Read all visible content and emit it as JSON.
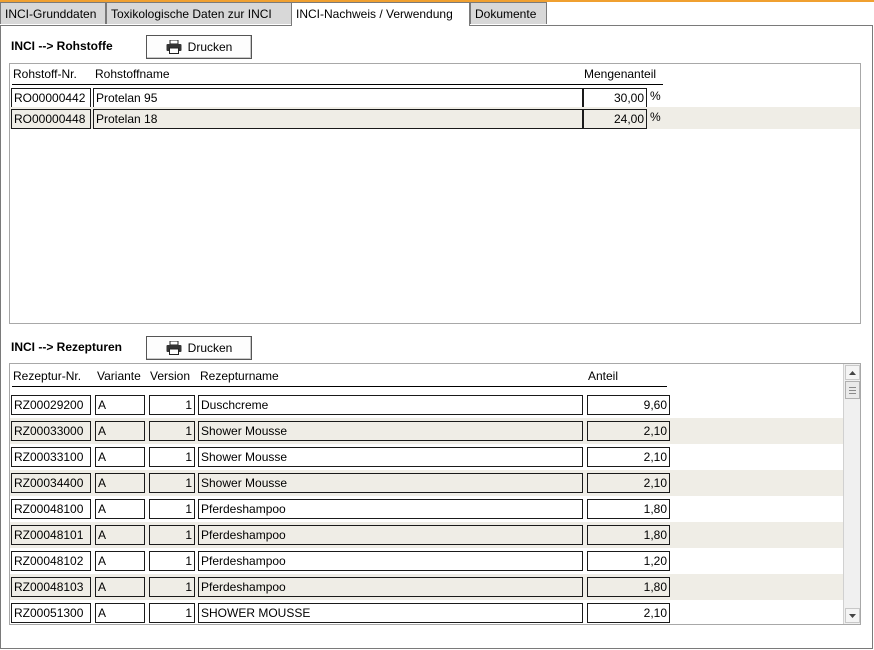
{
  "tabs": [
    {
      "label": "INCI-Grunddaten"
    },
    {
      "label": "Toxikologische Daten zur INCI"
    },
    {
      "label": "INCI-Nachweis / Verwendung"
    },
    {
      "label": "Dokumente"
    }
  ],
  "rohstoffe": {
    "title": "INCI --> Rohstoffe",
    "print_label": "Drucken",
    "columns": {
      "nr": "Rohstoff-Nr.",
      "name": "Rohstoffname",
      "menge": "Mengenanteil"
    },
    "rows": [
      {
        "nr": "RO00000442",
        "name": "Protelan 95",
        "menge": "30,00",
        "unit": "%"
      },
      {
        "nr": "RO00000448",
        "name": "Protelan 18",
        "menge": "24,00",
        "unit": "%"
      }
    ]
  },
  "rezepturen": {
    "title": "INCI --> Rezepturen",
    "print_label": "Drucken",
    "columns": {
      "nr": "Rezeptur-Nr.",
      "variante": "Variante",
      "version": "Version",
      "name": "Rezepturname",
      "anteil": "Anteil"
    },
    "rows": [
      {
        "nr": "RZ00029200",
        "variante": "A",
        "version": "1",
        "name": "Duschcreme",
        "anteil": "9,60"
      },
      {
        "nr": "RZ00033000",
        "variante": "A",
        "version": "1",
        "name": "Shower Mousse",
        "anteil": "2,10"
      },
      {
        "nr": "RZ00033100",
        "variante": "A",
        "version": "1",
        "name": "Shower Mousse",
        "anteil": "2,10"
      },
      {
        "nr": "RZ00034400",
        "variante": "A",
        "version": "1",
        "name": "Shower Mousse",
        "anteil": "2,10"
      },
      {
        "nr": "RZ00048100",
        "variante": "A",
        "version": "1",
        "name": "Pferdeshampoo",
        "anteil": "1,80"
      },
      {
        "nr": "RZ00048101",
        "variante": "A",
        "version": "1",
        "name": "Pferdeshampoo",
        "anteil": "1,80"
      },
      {
        "nr": "RZ00048102",
        "variante": "A",
        "version": "1",
        "name": "Pferdeshampoo",
        "anteil": "1,20"
      },
      {
        "nr": "RZ00048103",
        "variante": "A",
        "version": "1",
        "name": "Pferdeshampoo",
        "anteil": "1,80"
      },
      {
        "nr": "RZ00051300",
        "variante": "A",
        "version": "1",
        "name": "SHOWER MOUSSE",
        "anteil": "2,10"
      }
    ]
  },
  "icons": {
    "print": "printer-icon",
    "scroll_up": "arrow-up-icon",
    "scroll_down": "arrow-down-icon"
  }
}
